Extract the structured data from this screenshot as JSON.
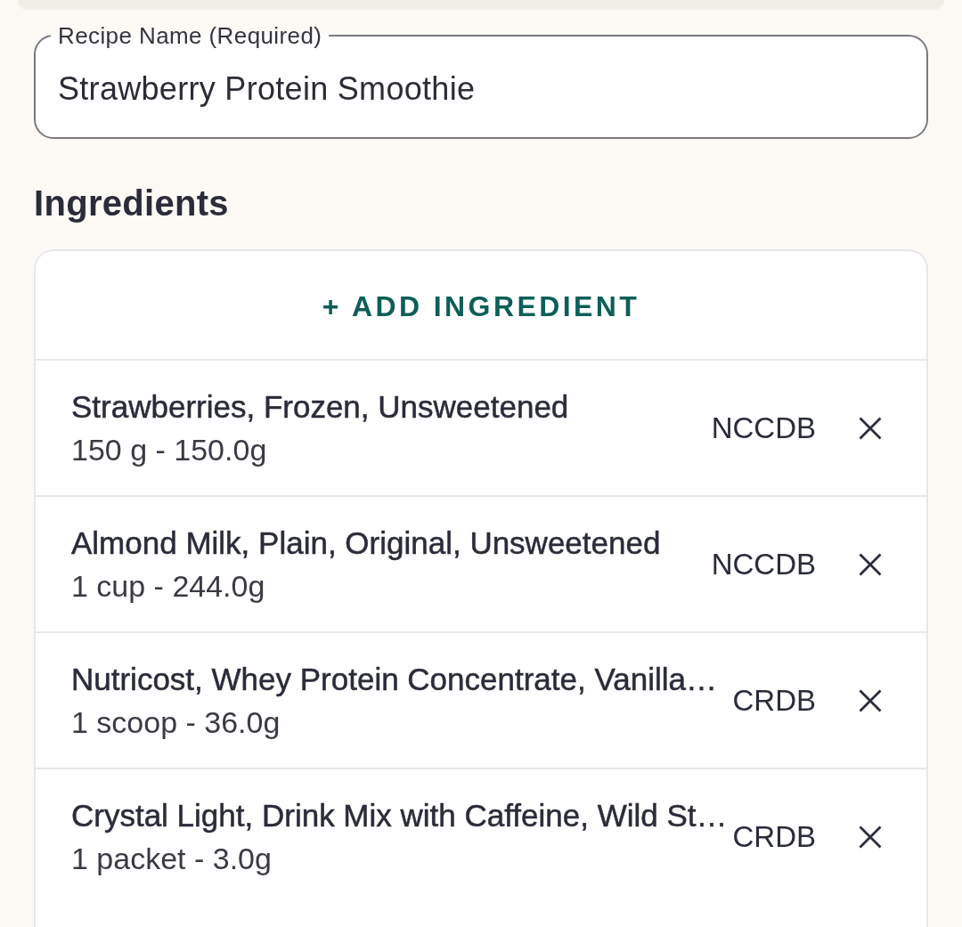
{
  "recipe_name_field": {
    "label": "Recipe Name (Required)",
    "value": "Strawberry Protein Smoothie"
  },
  "ingredients": {
    "title": "Ingredients",
    "add_button": "+ ADD INGREDIENT",
    "items": [
      {
        "name": "Strawberries, Frozen, Unsweetened",
        "amount": "150 g - 150.0g",
        "source": "NCCDB"
      },
      {
        "name": "Almond Milk, Plain, Original, Unsweetened",
        "amount": "1 cup - 244.0g",
        "source": "NCCDB"
      },
      {
        "name": "Nutricost, Whey Protein Concentrate, Vanilla…",
        "amount": "1 scoop - 36.0g",
        "source": "CRDB"
      },
      {
        "name": "Crystal Light, Drink Mix with Caffeine, Wild St…",
        "amount": "1 packet - 3.0g",
        "source": "CRDB"
      }
    ]
  }
}
